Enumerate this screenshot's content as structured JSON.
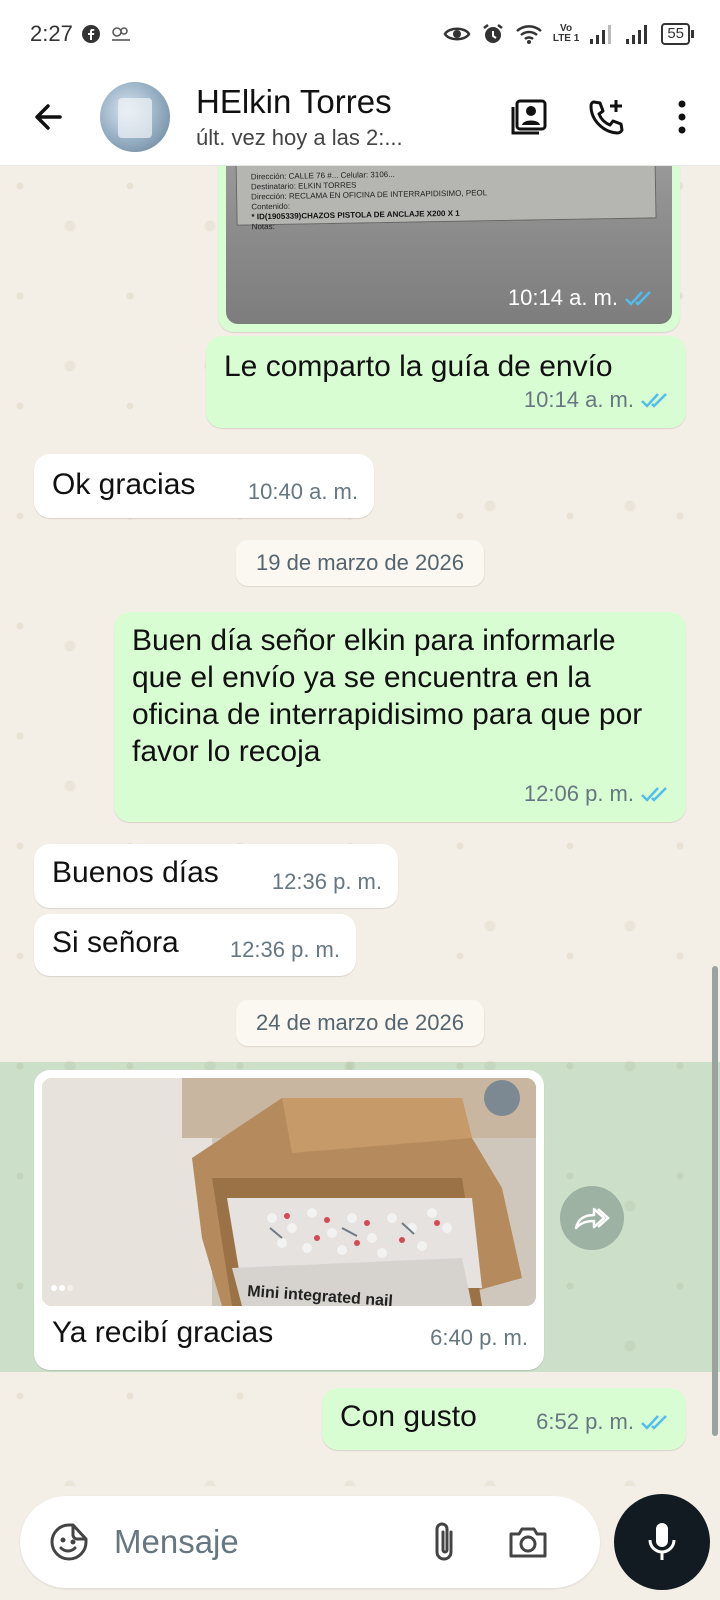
{
  "status_bar": {
    "time": "2:27",
    "volte_top": "Vo",
    "volte_bottom": "LTE 1",
    "battery": "55"
  },
  "header": {
    "contact_name": "HElkin Torres",
    "last_seen": "últ. vez hoy a las 2:..."
  },
  "chat": {
    "messages": [
      {
        "type": "image",
        "direction": "out",
        "time": "10:14 a. m.",
        "doc_text": [
          "Dirección: CALLE 76 #...  Celular: 3106...",
          "Destinatario: ELKIN TORRES",
          "Dirección: RECLAMA EN OFICINA DE INTERRAPIDISIMO, PEOL",
          "Contenido:",
          "* ID(1905339)CHAZOS PISTOLA DE ANCLAJE X200 X 1",
          "Notas:"
        ]
      },
      {
        "type": "text",
        "direction": "out",
        "text": "Le comparto la guía de envío",
        "time": "10:14 a. m."
      },
      {
        "type": "text",
        "direction": "in",
        "text": "Ok gracias",
        "time": "10:40 a. m."
      },
      {
        "type": "date",
        "text": "19 de marzo de 2026"
      },
      {
        "type": "text",
        "direction": "out",
        "text": "Buen día señor elkin para informarle que el envío ya se encuentra en la oficina de interrapidisimo para que por favor lo recoja",
        "time": "12:06 p. m."
      },
      {
        "type": "text",
        "direction": "in",
        "text": "Buenos días",
        "time": "12:36 p. m."
      },
      {
        "type": "text",
        "direction": "in",
        "text": "Si señora",
        "time": "12:36 p. m."
      },
      {
        "type": "date",
        "text": "24 de marzo de 2026"
      },
      {
        "type": "image",
        "direction": "in",
        "caption": "Ya recibí gracias",
        "time": "6:40 p. m.",
        "box_label": "Mini integrated nail"
      },
      {
        "type": "text",
        "direction": "out",
        "text": "Con gusto",
        "time": "6:52 p. m."
      }
    ]
  },
  "composer": {
    "placeholder": "Mensaje"
  },
  "colors": {
    "outgoing_bubble": "#d9fdd3",
    "incoming_bubble": "#ffffff",
    "read_ticks": "#53bdeb",
    "mic_button": "#111b21"
  },
  "icons": [
    "back-arrow-icon",
    "contact-card-icon",
    "add-call-icon",
    "more-vert-icon",
    "sticker-icon",
    "attach-icon",
    "camera-icon",
    "mic-icon",
    "forward-icon",
    "facebook-icon",
    "eye-icon",
    "alarm-icon",
    "wifi-icon",
    "signal-icon"
  ]
}
